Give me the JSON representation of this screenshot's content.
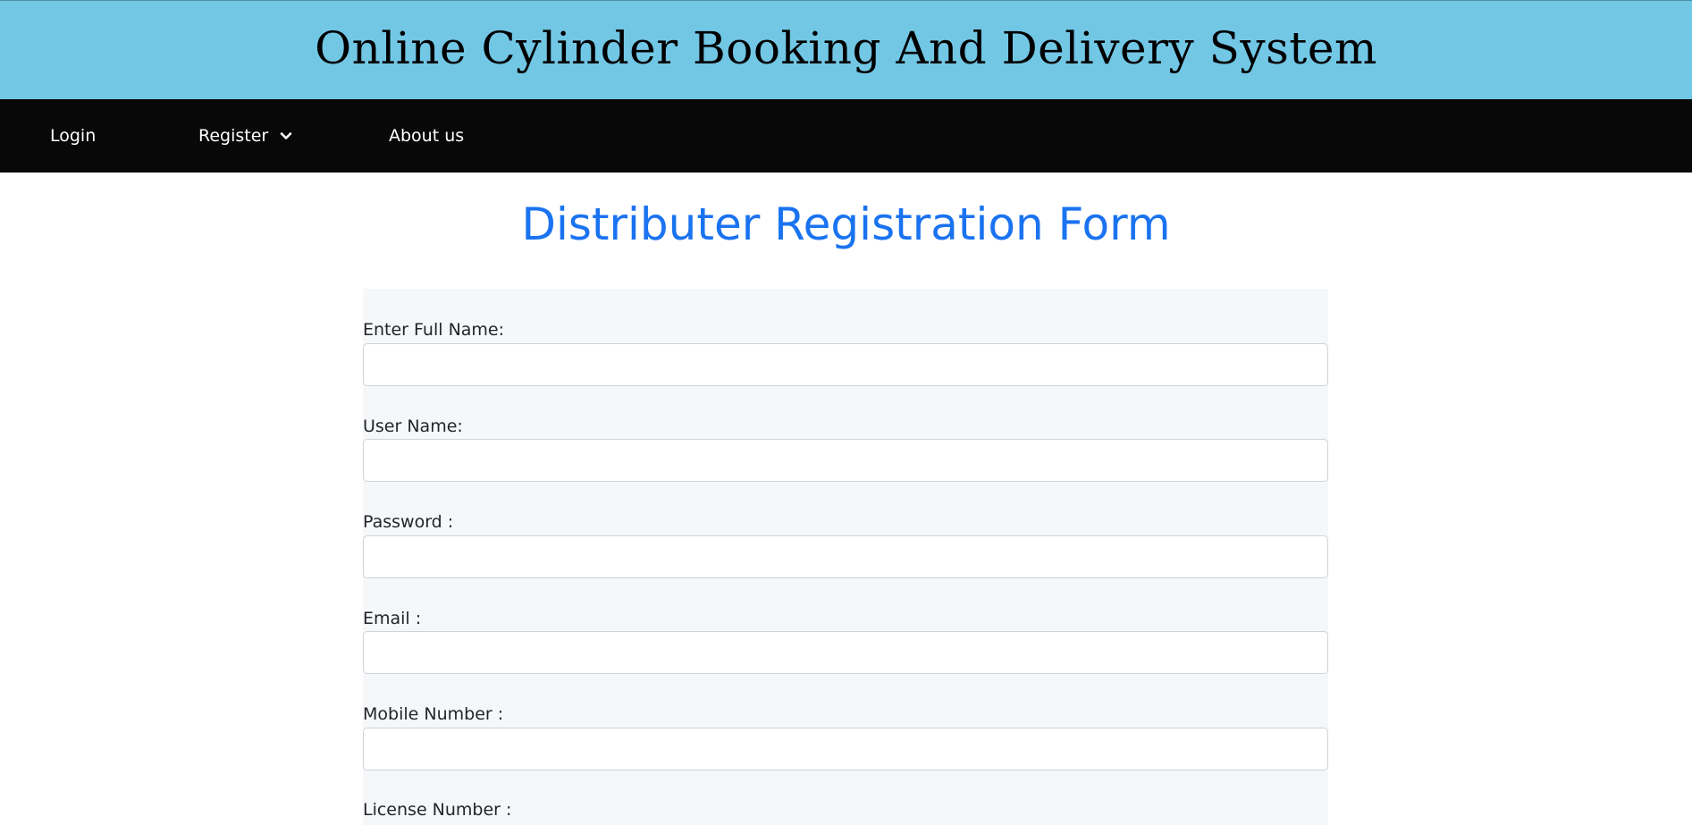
{
  "header": {
    "title": "Online Cylinder Booking And Delivery System"
  },
  "nav": {
    "login": "Login",
    "register": "Register",
    "about": "About us"
  },
  "form": {
    "heading": "Distributer Registration Form",
    "fields": {
      "full_name": {
        "label": "Enter Full Name:",
        "value": ""
      },
      "user_name": {
        "label": "User Name:",
        "value": ""
      },
      "password": {
        "label": "Password :",
        "value": ""
      },
      "email": {
        "label": "Email :",
        "value": ""
      },
      "mobile": {
        "label": "Mobile Number :",
        "value": ""
      },
      "license": {
        "label": "License Number :"
      }
    }
  },
  "colors": {
    "banner": "#72c7e5",
    "navbar": "#080808",
    "heading": "#1a73f0",
    "panel": "#f6f7f9"
  },
  "icons": {
    "register_dropdown": "chevron-down-icon"
  }
}
